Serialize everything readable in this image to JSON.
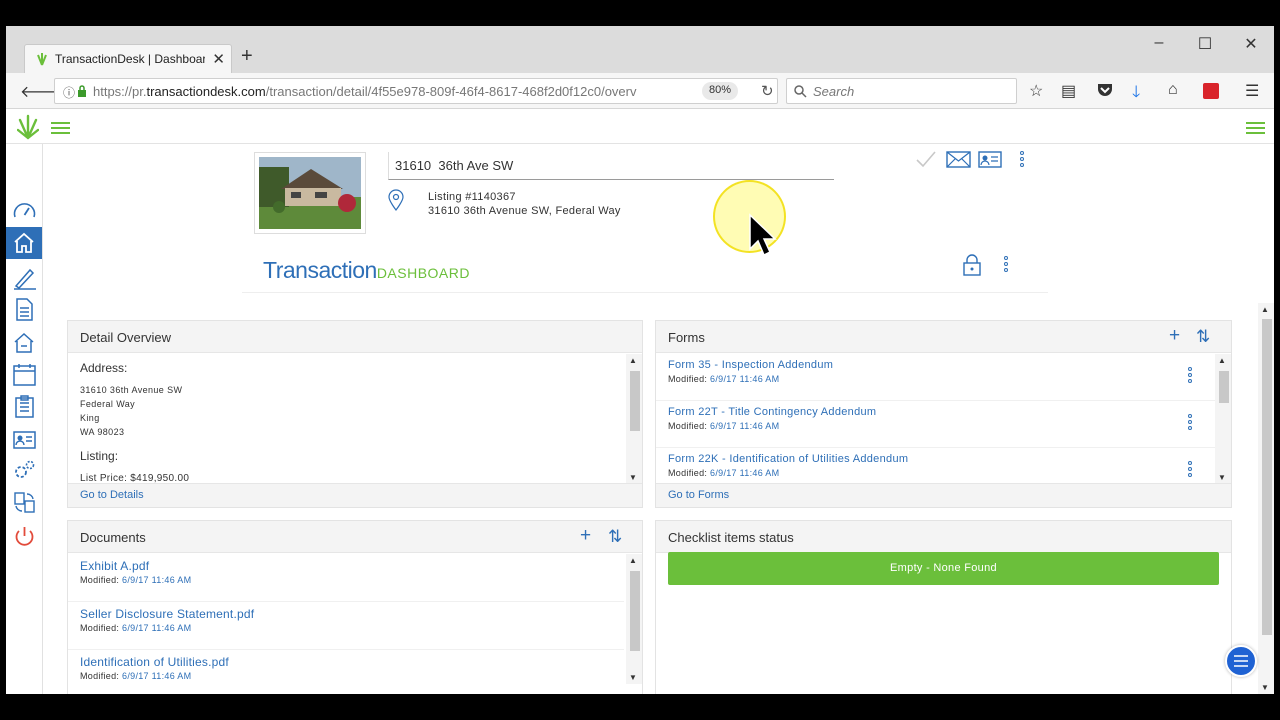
{
  "browser": {
    "tab_title": "TransactionDesk | Dashboard",
    "url_prefix": "https://pr.",
    "url_domain": "transactiondesk.com",
    "url_path": "/transaction/detail/4f55e978-809f-46f4-8617-468f2d0f12c0/overv",
    "zoom": "80%",
    "search_placeholder": "Search"
  },
  "header": {
    "address_value": "31610  36th Ave SW",
    "listing_number": "Listing #1140367",
    "listing_address": "31610 36th Avenue SW, Federal Way",
    "brand_main": "Transaction",
    "brand_sub": "DASHBOARD"
  },
  "detail_overview": {
    "title": "Detail Overview",
    "address_label": "Address:",
    "address_lines": [
      "31610 36th Avenue SW",
      "Federal Way",
      "King",
      "WA 98023"
    ],
    "listing_label": "Listing:",
    "list_price": "List Price: $419,950.00",
    "footer_link": "Go to Details"
  },
  "forms": {
    "title": "Forms",
    "items": [
      {
        "title": "Form 35 - Inspection Addendum",
        "modified_label": "Modified:",
        "modified_date": "6/9/17 11:46 AM"
      },
      {
        "title": "Form 22T - Title Contingency Addendum",
        "modified_label": "Modified:",
        "modified_date": "6/9/17 11:46 AM"
      },
      {
        "title": "Form 22K - Identification of Utilities Addendum",
        "modified_label": "Modified:",
        "modified_date": "6/9/17 11:46 AM"
      }
    ],
    "footer_link": "Go to Forms"
  },
  "documents": {
    "title": "Documents",
    "items": [
      {
        "title": "Exhibit A.pdf",
        "modified_label": "Modified:",
        "modified_date": "6/9/17 11:46 AM"
      },
      {
        "title": "Seller Disclosure Statement.pdf",
        "modified_label": "Modified:",
        "modified_date": "6/9/17 11:46 AM"
      },
      {
        "title": "Identification of Utilities.pdf",
        "modified_label": "Modified:",
        "modified_date": "6/9/17 11:46 AM"
      }
    ]
  },
  "checklist": {
    "title": "Checklist items status",
    "empty_button": "Empty - None Found"
  },
  "colors": {
    "accent_blue": "#2e6fb7",
    "brand_green": "#6bbf3b"
  }
}
